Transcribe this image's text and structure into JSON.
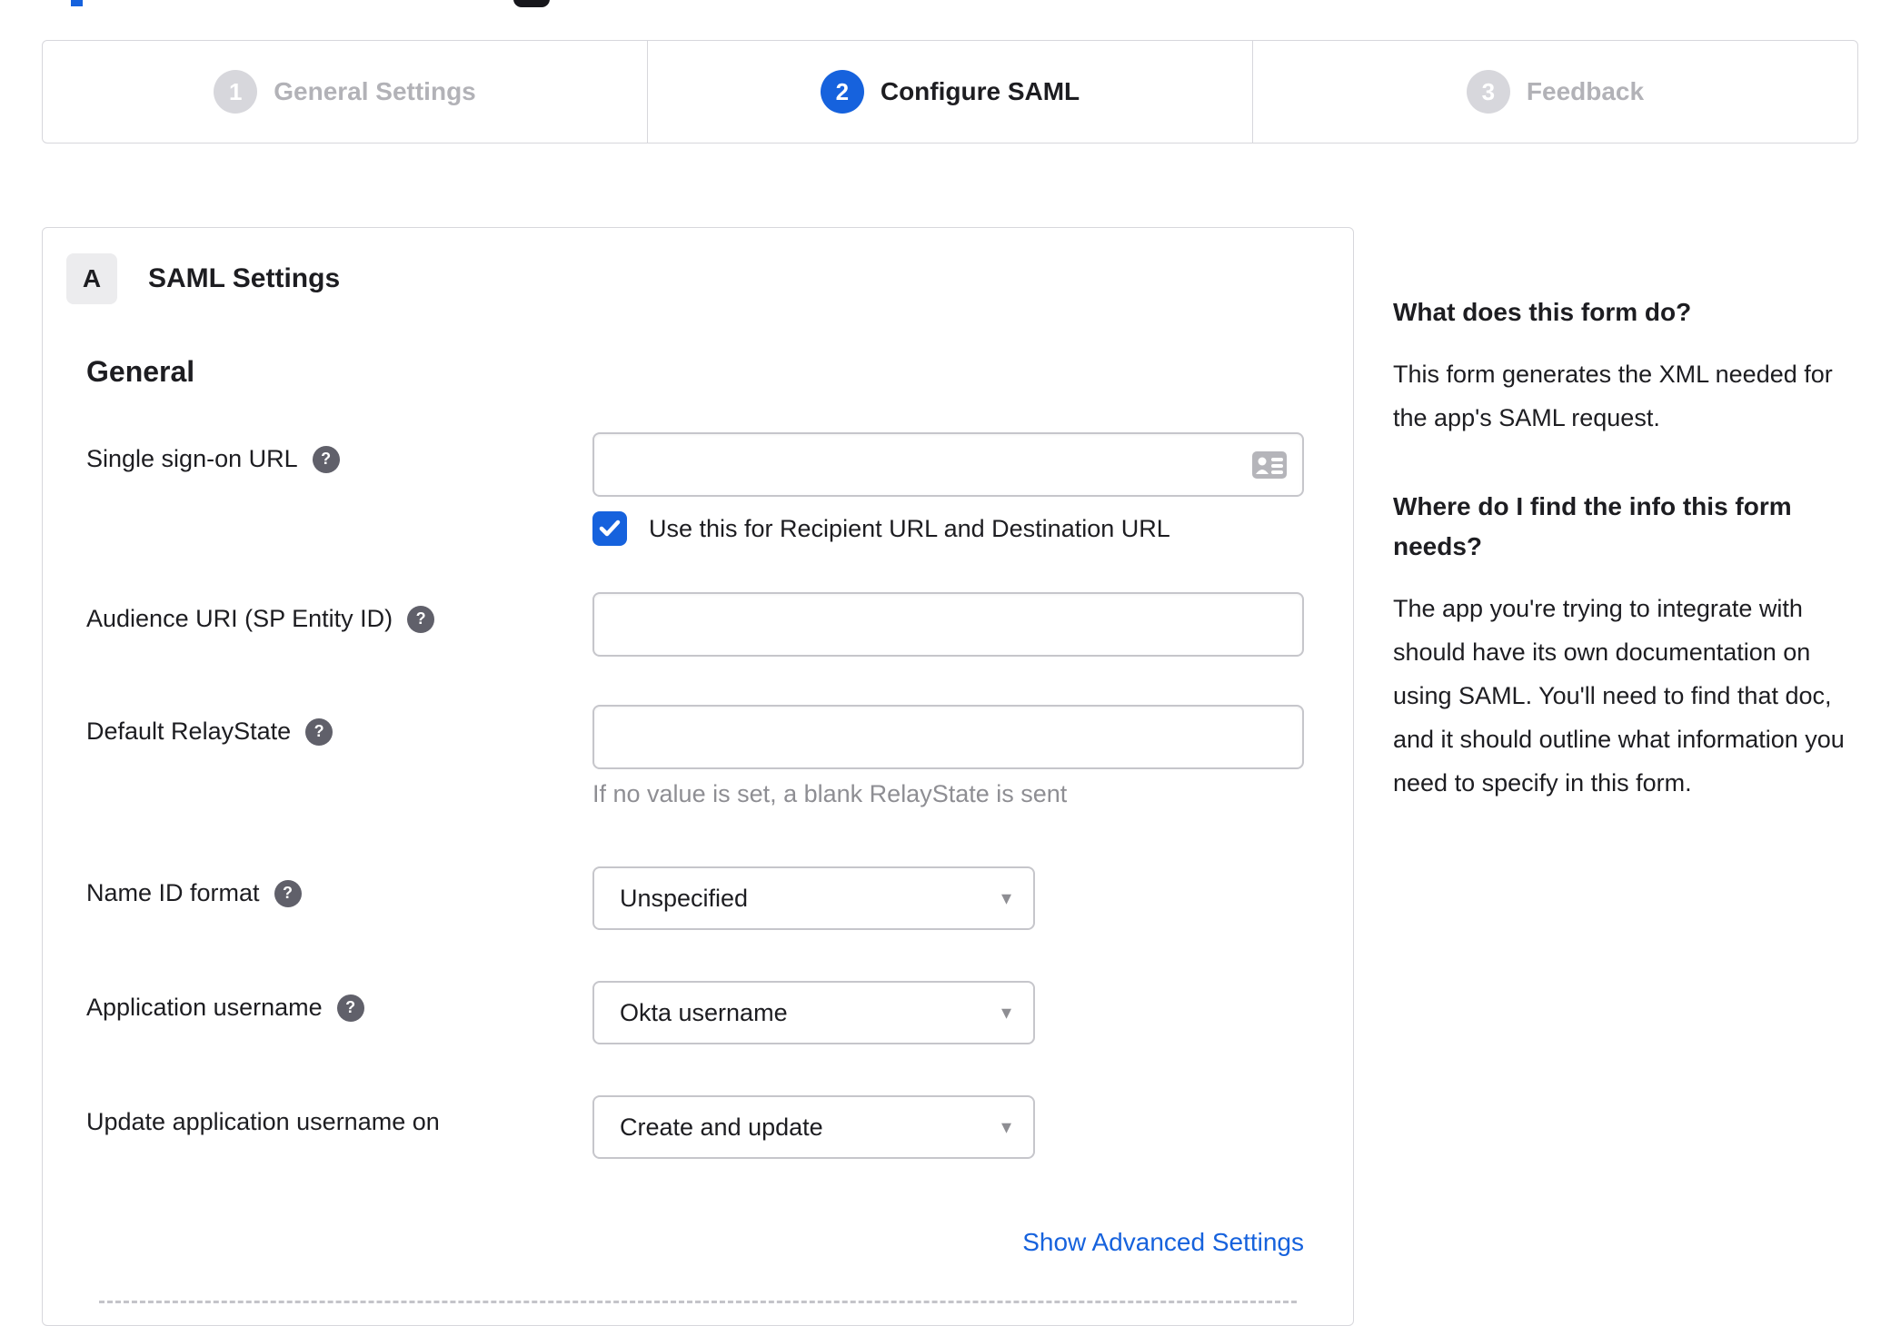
{
  "icons": {
    "help": "?",
    "caret": "▾"
  },
  "colors": {
    "accent": "#1662dd",
    "border": "#d7d7dc",
    "muted_text": "#8e8e93",
    "inactive_step": "#b2b2b7"
  },
  "wizard": {
    "steps": [
      {
        "number": "1",
        "label": "General Settings",
        "state": "inactive"
      },
      {
        "number": "2",
        "label": "Configure SAML",
        "state": "active"
      },
      {
        "number": "3",
        "label": "Feedback",
        "state": "inactive"
      }
    ]
  },
  "panel": {
    "section_letter": "A",
    "section_title": "SAML Settings",
    "group_heading": "General",
    "advanced_link_label": "Show Advanced Settings"
  },
  "form": {
    "sso_url": {
      "label": "Single sign-on URL",
      "value": "",
      "checkbox_label": "Use this for Recipient URL and Destination URL",
      "checkbox_checked": true
    },
    "audience_uri": {
      "label": "Audience URI (SP Entity ID)",
      "value": ""
    },
    "default_relaystate": {
      "label": "Default RelayState",
      "value": "",
      "helper": "If no value is set, a blank RelayState is sent"
    },
    "name_id_format": {
      "label": "Name ID format",
      "value": "Unspecified"
    },
    "application_username": {
      "label": "Application username",
      "value": "Okta username"
    },
    "update_app_username_on": {
      "label": "Update application username on",
      "value": "Create and update"
    }
  },
  "sidebar": {
    "blocks": [
      {
        "heading": "What does this form do?",
        "body": "This form generates the XML needed for the app's SAML request."
      },
      {
        "heading": "Where do I find the info this form needs?",
        "body": "The app you're trying to integrate with should have its own documentation on using SAML. You'll need to find that doc, and it should outline what information you need to specify in this form."
      }
    ]
  }
}
